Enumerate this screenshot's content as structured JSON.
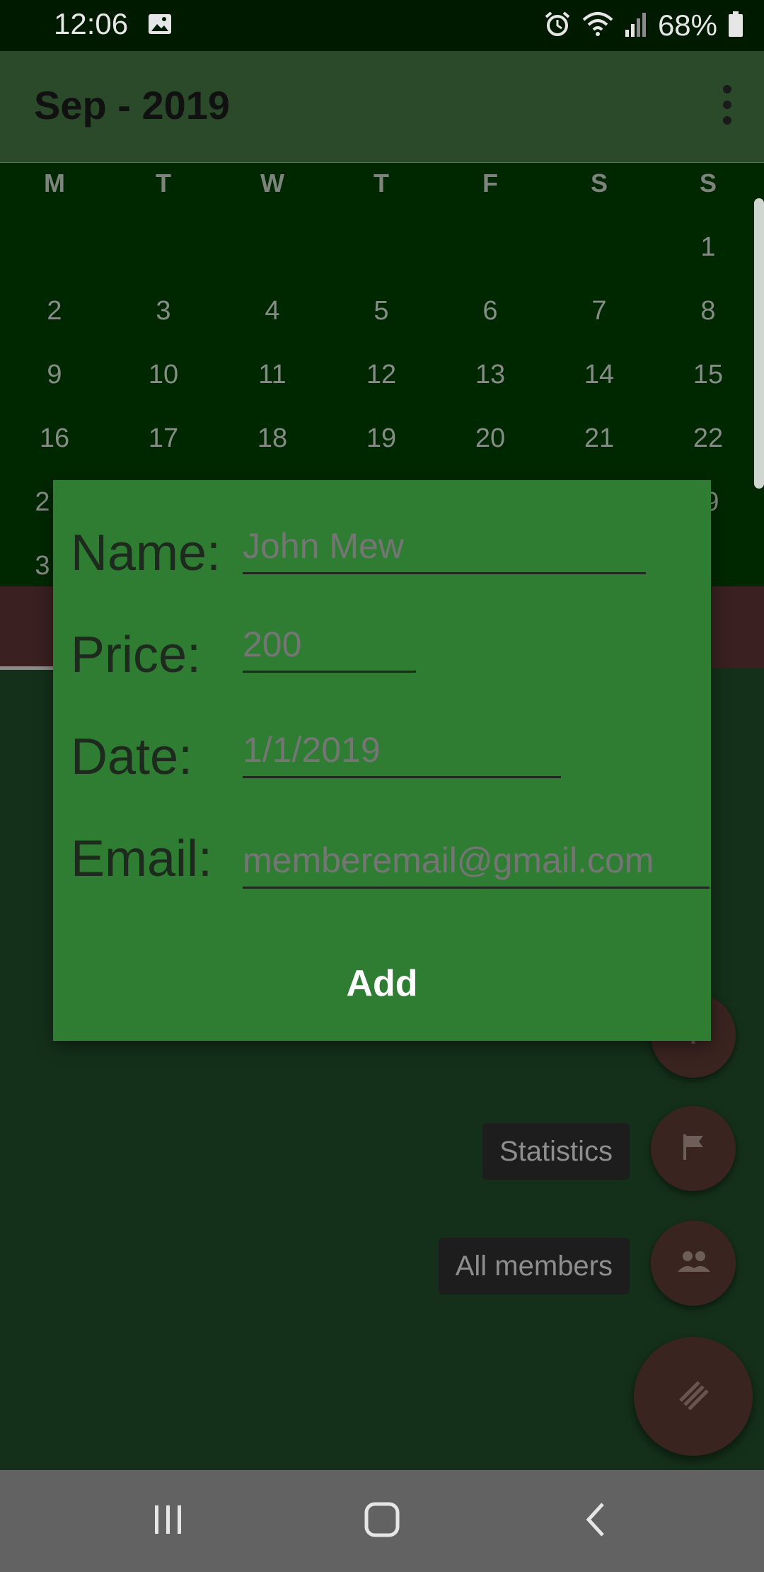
{
  "status_bar": {
    "time": "12:06",
    "battery": "68%"
  },
  "app_bar": {
    "title": "Sep - 2019"
  },
  "calendar": {
    "weekdays": [
      "M",
      "T",
      "W",
      "T",
      "F",
      "S",
      "S"
    ],
    "weeks": [
      [
        "",
        "",
        "",
        "",
        "",
        "",
        "1"
      ],
      [
        "2",
        "3",
        "4",
        "5",
        "6",
        "7",
        "8"
      ],
      [
        "9",
        "10",
        "11",
        "12",
        "13",
        "14",
        "15"
      ],
      [
        "16",
        "17",
        "18",
        "19",
        "20",
        "21",
        "22"
      ],
      [
        "2",
        "",
        "",
        "",
        "",
        "",
        "9"
      ],
      [
        "3",
        "",
        "",
        "",
        "",
        "",
        ""
      ]
    ]
  },
  "dialog": {
    "name_label": "Name:",
    "name_placeholder": "John Mew",
    "price_label": "Price:",
    "price_placeholder": "200",
    "date_label": "Date:",
    "date_placeholder": "1/1/2019",
    "email_label": "Email:",
    "email_placeholder": "memberemail@gmail.com",
    "add_label": "Add"
  },
  "fab_menu": {
    "statistics_label": "Statistics",
    "all_members_label": "All members"
  },
  "colors": {
    "dialog_bg": "#2e7d32",
    "calendar_bg": "#002800",
    "fab_bg": "#3a2420"
  }
}
